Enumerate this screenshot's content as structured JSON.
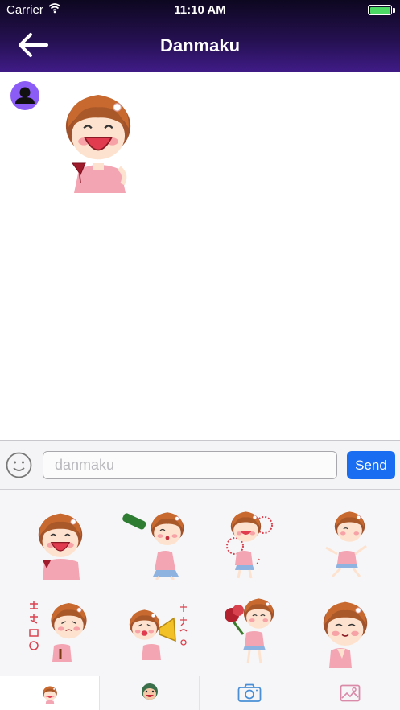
{
  "status_bar": {
    "carrier": "Carrier",
    "time": "11:10 AM",
    "wifi_icon": "wifi-icon",
    "battery_icon": "battery-full-icon"
  },
  "nav": {
    "title": "Danmaku",
    "back_icon": "arrow-left-icon"
  },
  "messages": [
    {
      "sender_icon": "person-icon",
      "type": "sticker",
      "sticker": "girl-laughing-wine"
    }
  ],
  "input_bar": {
    "emoji_icon": "smiley-icon",
    "placeholder": "danmaku",
    "value": "",
    "send_label": "Send"
  },
  "sticker_panel": {
    "stickers": [
      "girl-laughing-wine",
      "girl-drinking-bottle",
      "girl-cheerleader-pompom",
      "girl-dancing",
      "girl-crying-chinese-text",
      "girl-megaphone-chinese-text",
      "girl-holding-bouquet",
      "girl-praying-shy"
    ]
  },
  "tabs": [
    {
      "icon": "cartoon-girl-icon",
      "active": true
    },
    {
      "icon": "cartoon-character-icon",
      "active": false
    },
    {
      "icon": "camera-icon",
      "active": false
    },
    {
      "icon": "image-icon",
      "active": false
    }
  ],
  "colors": {
    "header_top": "#0d0720",
    "header_bottom": "#3f1b86",
    "send_button": "#1a6cf0",
    "avatar": "#8b5cf6",
    "battery": "#4cd964"
  }
}
